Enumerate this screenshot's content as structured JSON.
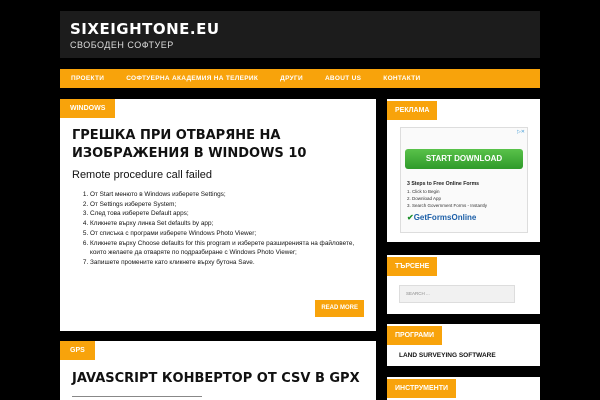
{
  "header": {
    "title": "SIXEIGHTONE.EU",
    "tagline": "СВОБОДЕН СОФТУЕР"
  },
  "nav": {
    "items": [
      "ПРОЕКТИ",
      "СОФТУЕРНА АКАДЕМИЯ НА ТЕЛЕРИК",
      "ДРУГИ",
      "ABOUT US",
      "КОНТАКТИ"
    ]
  },
  "post1": {
    "category": "WINDOWS",
    "title": "ГРЕШКА ПРИ ОТВАРЯНЕ НА ИЗОБРАЖЕНИЯ В WINDOWS 10",
    "subtitle": "Remote procedure call failed",
    "steps": [
      "От Start менюто в Windows изберете Settings;",
      "От Settings изберете System;",
      "След това изберете Default apps;",
      "Кликнете върху линка Set defaults by app;",
      "От списъка с програми изберете Windows Photo Viewer;",
      "Кликнете върху Choose defaults for this program и изберете разширенията на файловете, които желаете да отваряте по подразбиране с Windows Photo Viewer;",
      "Запишете промените като кликнете върху бутона Save."
    ],
    "read_more": "READ MORE"
  },
  "post2": {
    "category": "GPS",
    "title": "JAVASCRIPT КОНВЕРТОР ОТ CSV В GPX"
  },
  "sidebar": {
    "ads": {
      "title": "РЕКЛАМА",
      "button": "START DOWNLOAD",
      "headline": "3 Steps to Free Online Forms",
      "lines": [
        "1. Click to Begin",
        "2. Download App",
        "3. Search Government Forms - Instantly"
      ],
      "logo": "GetFormsOnline"
    },
    "search": {
      "title": "ТЪРСЕНЕ",
      "placeholder": "SEARCH ..."
    },
    "programs": {
      "title": "ПРОГРАМИ",
      "link": "LAND SURVEYING SOFTWARE"
    },
    "tools": {
      "title": "ИНСТРУМЕНТИ"
    }
  },
  "colors": {
    "accent": "#f8a30b",
    "background": "#000000",
    "header": "#1c1c1c"
  }
}
